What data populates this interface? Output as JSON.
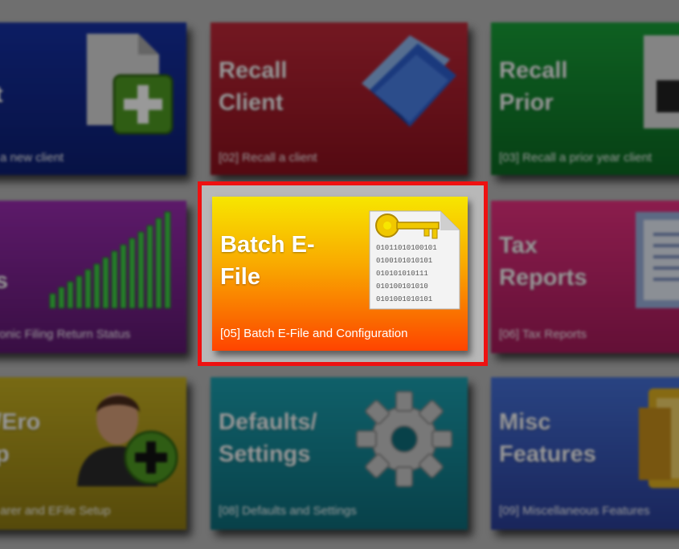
{
  "tiles": [
    {
      "title": "t",
      "caption": "a new client",
      "icon": "new-document-plus-icon"
    },
    {
      "title": "Recall\nClient",
      "caption": "[02] Recall a client",
      "icon": "open-folder-icon"
    },
    {
      "title": "Recall\nPrior",
      "caption": "[03] Recall a prior year client",
      "icon": "document-icon"
    },
    {
      "title": "\ns",
      "caption": "ronic Filing Return Status",
      "icon": "bar-chart-icon"
    },
    {
      "title": "Batch E-\nFile",
      "caption": "[05] Batch E-File and Configuration",
      "icon": "key-document-icon"
    },
    {
      "title": "Tax\nReports",
      "caption": "[06] Tax Reports",
      "icon": "report-icon"
    },
    {
      "title": "/Ero\np",
      "caption": "arer and EFile Setup",
      "icon": "user-add-icon"
    },
    {
      "title": "Defaults/\nSettings",
      "caption": "[08] Defaults and Settings",
      "icon": "gear-icon"
    },
    {
      "title": "Misc\nFeatures",
      "caption": "[09] Miscellaneous Features",
      "icon": "folders-icon"
    }
  ],
  "binary_lines": [
    "01011010100101",
    "0100101010101",
    "010101010111",
    "010100101010",
    "0101001010101"
  ],
  "colors": {
    "highlight": "#ee1111"
  }
}
